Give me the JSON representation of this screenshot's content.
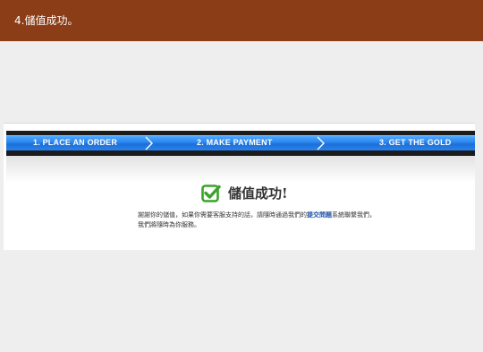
{
  "header": {
    "title": "4.儲值成功。"
  },
  "steps": {
    "step1": "1. PLACE AN ORDER",
    "step2": "2.  MAKE PAYMENT",
    "step3": "3.  GET THE GOLD"
  },
  "result": {
    "title": "儲值成功!",
    "message_part1": "謝謝你的儲值，如果你需要客服支持的話，請隨時通過我們的",
    "link_text": "提交問題",
    "message_part2": "系統聯繫我們，",
    "message_line2": "我們將隨時為你服務。"
  },
  "colors": {
    "header_bg": "#8a3d16",
    "steps_bar": "#2a84ec",
    "check_green": "#3aa329",
    "link": "#1a4fa3"
  },
  "icons": {
    "check": "check-icon",
    "chevron": "chevron-right-icon"
  }
}
